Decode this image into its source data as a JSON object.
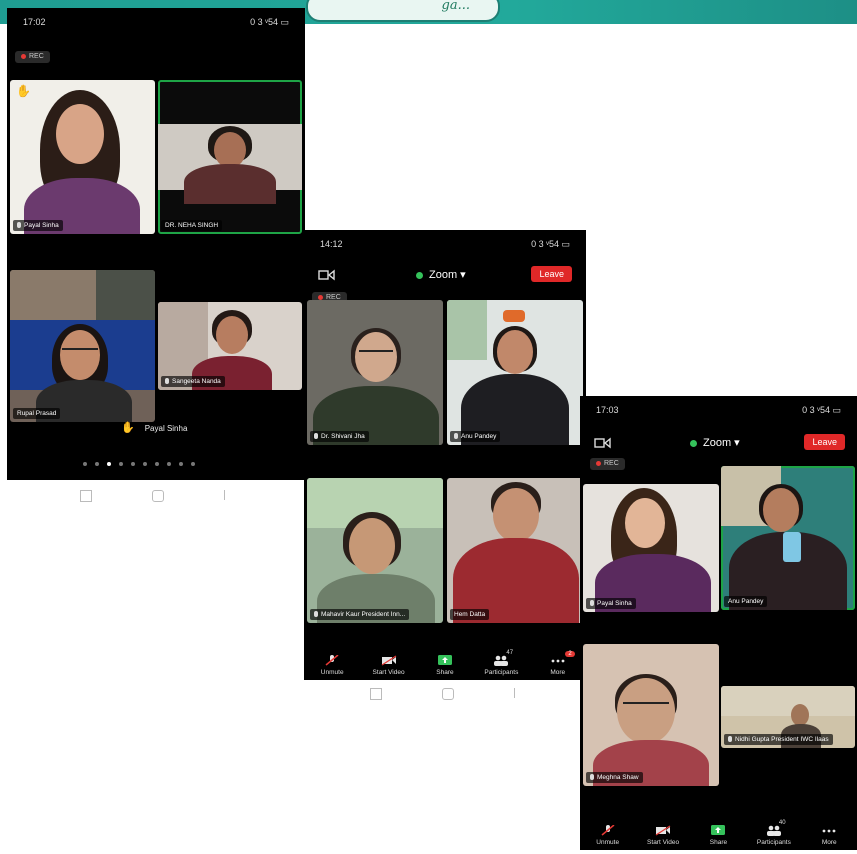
{
  "banner": {
    "text": "ga..."
  },
  "phone1": {
    "time": "17:02",
    "status_right": "0 3 ᵛ54 ▭",
    "rec": "REC",
    "tiles": [
      {
        "name": "Payal Sinha"
      },
      {
        "name": "DR. NEHA SINGH"
      },
      {
        "name": "Rupal Prasad"
      },
      {
        "name": "Sangeeta Nanda"
      }
    ],
    "speaker": "Payal Sinha",
    "pages": 10,
    "current_page": 3
  },
  "phone2": {
    "time": "14:12",
    "status_right": "0 3 ᵛ54 ▭",
    "title": "Zoom",
    "leave": "Leave",
    "rec": "REC",
    "tiles": [
      {
        "name": "Dr. Shivani Jha"
      },
      {
        "name": "Anu Pandey"
      },
      {
        "name": "Mahavir Kaur President Inn..."
      },
      {
        "name": "Hem Datta"
      }
    ],
    "toolbar": [
      {
        "label": "Unmute",
        "icon": "mic-muted-icon"
      },
      {
        "label": "Start Video",
        "icon": "video-off-icon"
      },
      {
        "label": "Share",
        "icon": "share-screen-icon"
      },
      {
        "label": "Participants",
        "icon": "participants-icon",
        "count": "47"
      },
      {
        "label": "More",
        "icon": "more-icon",
        "badge": "2"
      }
    ]
  },
  "phone3": {
    "time": "17:03",
    "status_right": "0 3 ᵛ54 ▭",
    "title": "Zoom",
    "leave": "Leave",
    "rec": "REC",
    "tiles": [
      {
        "name": "Payal Sinha"
      },
      {
        "name": "Anu Pandey"
      },
      {
        "name": "Meghna Shaw"
      },
      {
        "name": "Nidhi Gupta President IWC Ilaas"
      }
    ],
    "toolbar": [
      {
        "label": "Unmute",
        "icon": "mic-muted-icon"
      },
      {
        "label": "Start Video",
        "icon": "video-off-icon"
      },
      {
        "label": "Share",
        "icon": "share-screen-icon"
      },
      {
        "label": "Participants",
        "icon": "participants-icon",
        "count": "40"
      },
      {
        "label": "More",
        "icon": "more-icon"
      }
    ]
  },
  "colors": {
    "leave": "#e02828",
    "share": "#35c25b",
    "active_speaker": "#1ea446",
    "banner": "#22a99b"
  }
}
